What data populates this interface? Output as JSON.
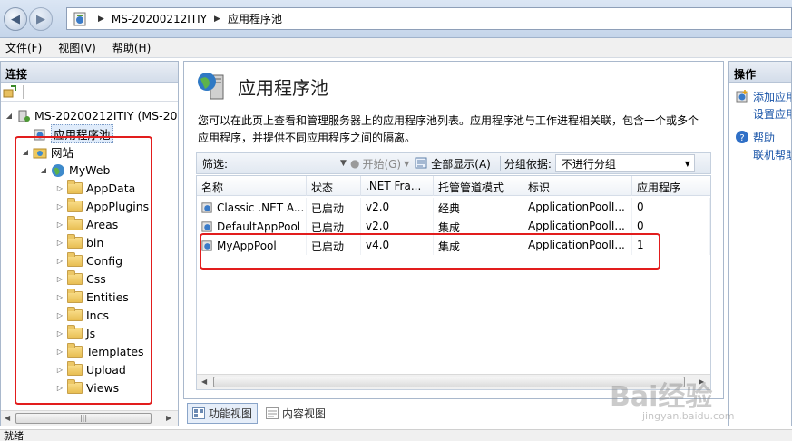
{
  "address": {
    "crumbs": [
      "MS-20200212ITIY",
      "应用程序池"
    ]
  },
  "menu": [
    "文件(F)",
    "视图(V)",
    "帮助(H)"
  ],
  "connections": {
    "header": "连接",
    "server": "MS-20200212ITIY (MS-202",
    "app_pools": "应用程序池",
    "sites": "网站",
    "site": "MyWeb",
    "folders": [
      "AppData",
      "AppPlugins",
      "Areas",
      "bin",
      "Config",
      "Css",
      "Entities",
      "Incs",
      "Js",
      "Templates",
      "Upload",
      "Views"
    ]
  },
  "main": {
    "title": "应用程序池",
    "description_line1": "您可以在此页上查看和管理服务器上的应用程序池列表。应用程序池与工作进程相关联，包含一个或多个",
    "description_line2": "应用程序，并提供不同应用程序之间的隔离。",
    "filter_label": "筛选:",
    "start_label": "开始(G)",
    "show_all_label": "全部显示(A)",
    "group_by_label": "分组依据:",
    "group_by_value": "不进行分组",
    "columns": [
      "名称",
      "状态",
      ".NET Fra...",
      "托管管道模式",
      "标识",
      "应用程序"
    ],
    "rows": [
      [
        "Classic .NET A...",
        "已启动",
        "v2.0",
        "经典",
        "ApplicationPoolI...",
        "0"
      ],
      [
        "DefaultAppPool",
        "已启动",
        "v2.0",
        "集成",
        "ApplicationPoolI...",
        "0"
      ],
      [
        "MyAppPool",
        "已启动",
        "v4.0",
        "集成",
        "ApplicationPoolI...",
        "1"
      ]
    ],
    "tab_features": "功能视图",
    "tab_content": "内容视图"
  },
  "actions": {
    "header": "操作",
    "add_pool": "添加应用",
    "set_defaults": "设置应用",
    "help": "帮助",
    "online_help": "联机帮助"
  },
  "status": "就绪",
  "watermark": {
    "brand": "Bai经验",
    "url": "jingyan.baidu.com"
  }
}
